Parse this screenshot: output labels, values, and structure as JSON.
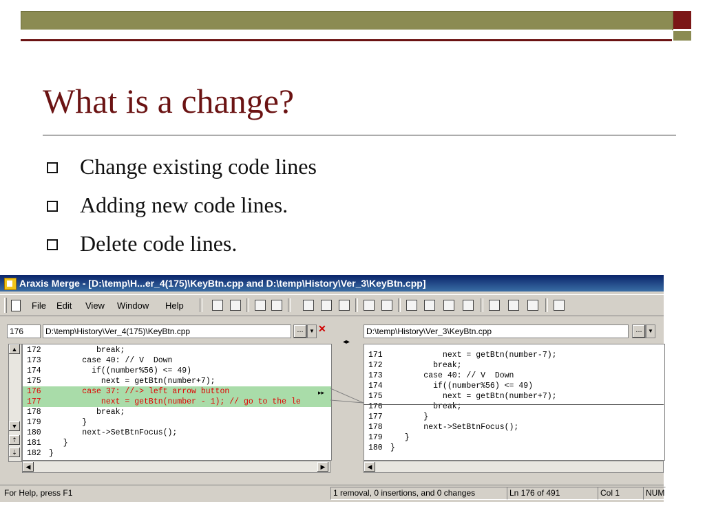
{
  "slide": {
    "title": "What is a change?",
    "bullets": [
      "Change existing code lines",
      "Adding new code lines.",
      "Delete code lines."
    ]
  },
  "window": {
    "title": "Araxis Merge - [D:\\temp\\H...er_4(175)\\KeyBtn.cpp and D:\\temp\\History\\Ver_3\\KeyBtn.cpp]",
    "menu": [
      "File",
      "Edit",
      "View",
      "Window",
      "Help"
    ]
  },
  "left": {
    "line_no": "176",
    "path": "D:\\temp\\History\\Ver_4(175)\\KeyBtn.cpp",
    "browse": "...",
    "lines": [
      {
        "n": "172",
        "t": "          break;"
      },
      {
        "n": "173",
        "t": "       case 40: // V  Down"
      },
      {
        "n": "174",
        "t": "         if((number%56) <= 49)"
      },
      {
        "n": "175",
        "t": "           next = getBtn(number+7);"
      },
      {
        "n": "176",
        "t": "       case 37: //-> left arrow button"
      },
      {
        "n": "177",
        "t": "           next = getBtn(number - 1); // go to the le"
      },
      {
        "n": "178",
        "t": "          break;"
      },
      {
        "n": "179",
        "t": "       }"
      },
      {
        "n": "180",
        "t": "       next->SetBtnFocus();"
      },
      {
        "n": "181",
        "t": "   }"
      },
      {
        "n": "182",
        "t": "}"
      }
    ]
  },
  "right": {
    "path": "D:\\temp\\History\\Ver_3\\KeyBtn.cpp",
    "browse": "...",
    "lines": [
      {
        "n": "171",
        "t": "           next = getBtn(number-7);"
      },
      {
        "n": "172",
        "t": "         break;"
      },
      {
        "n": "173",
        "t": "       case 40: // V  Down"
      },
      {
        "n": "174",
        "t": "         if((number%56) <= 49)"
      },
      {
        "n": "175",
        "t": "           next = getBtn(number+7);"
      },
      {
        "n": "176",
        "t": "         break;"
      },
      {
        "n": "177",
        "t": "       }"
      },
      {
        "n": "178",
        "t": "       next->SetBtnFocus();"
      },
      {
        "n": "179",
        "t": "   }"
      },
      {
        "n": "180",
        "t": "}"
      }
    ]
  },
  "status": {
    "help": "For Help, press F1",
    "summary": "1 removal, 0 insertions, and 0 changes",
    "position": "Ln 176 of 491",
    "column": "Col 1",
    "num": "NUM"
  },
  "colors": {
    "title": "#6b1313",
    "band": "#8b8b52",
    "removed_bg": "#a9dca9",
    "removed_text": "#e00000"
  }
}
